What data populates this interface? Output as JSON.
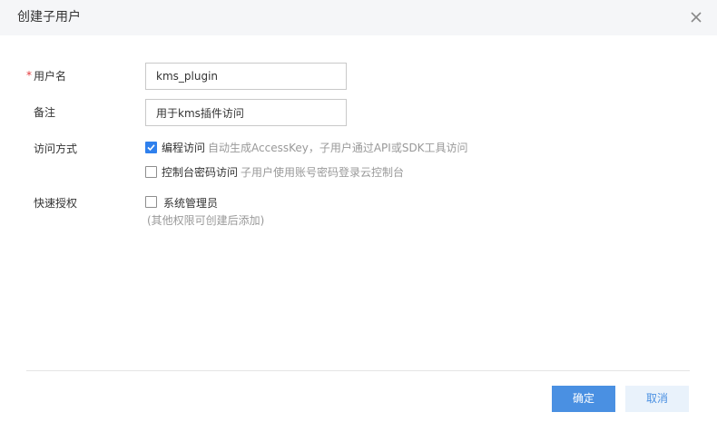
{
  "dialog": {
    "title": "创建子用户",
    "close_icon": "close-icon"
  },
  "form": {
    "username": {
      "required_mark": "*",
      "label": "用户名",
      "value": "kms_plugin"
    },
    "remark": {
      "label": "备注",
      "value": "用于kms插件访问"
    },
    "access_method": {
      "label": "访问方式",
      "options": [
        {
          "label": "编程访问",
          "checked": true,
          "description": "自动生成AccessKey，子用户通过API或SDK工具访问"
        },
        {
          "label": "控制台密码访问",
          "checked": false,
          "description": "子用户使用账号密码登录云控制台"
        }
      ]
    },
    "quick_auth": {
      "label": "快速授权",
      "option_label": "系统管理员",
      "checked": false,
      "hint": "(其他权限可创建后添加)"
    }
  },
  "footer": {
    "confirm_label": "确定",
    "cancel_label": "取消"
  },
  "colors": {
    "primary": "#4a90e2",
    "checkbox_checked": "#2f80ed",
    "required": "#e4393c",
    "header_bg": "#f5f6f8"
  }
}
